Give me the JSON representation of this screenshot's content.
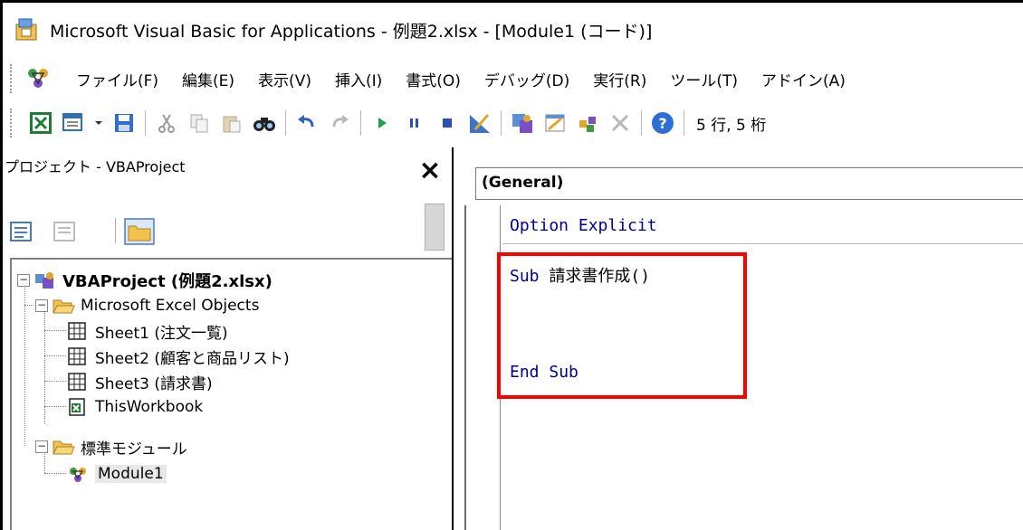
{
  "titlebar": {
    "title": "Microsoft Visual Basic for Applications - 例題2.xlsx - [Module1 (コード)]"
  },
  "menu": {
    "items": [
      "ファイル(F)",
      "編集(E)",
      "表示(V)",
      "挿入(I)",
      "書式(O)",
      "デバッグ(D)",
      "実行(R)",
      "ツール(T)",
      "アドイン(A)"
    ]
  },
  "toolbar": {
    "position_text": "5 行, 5 桁"
  },
  "project_pane": {
    "title": "プロジェクト - VBAProject",
    "close_label": "×",
    "tree": {
      "root": "VBAProject (例題2.xlsx)",
      "folder_excel_objects": "Microsoft Excel Objects",
      "sheet1": "Sheet1 (注文一覧)",
      "sheet2": "Sheet2 (顧客と商品リスト)",
      "sheet3": "Sheet3 (請求書)",
      "this_workbook": "ThisWorkbook",
      "folder_modules": "標準モジュール",
      "module1": "Module1"
    }
  },
  "code_pane": {
    "object_combo": "(General)",
    "line1_kw1": "Option",
    "line1_kw2": "Explicit",
    "line2_kw": "Sub",
    "line2_name": "請求書作成()",
    "line5_kw1": "End",
    "line5_kw2": "Sub"
  },
  "colors": {
    "keyword": "#00008b",
    "highlight": "#ff0000"
  }
}
